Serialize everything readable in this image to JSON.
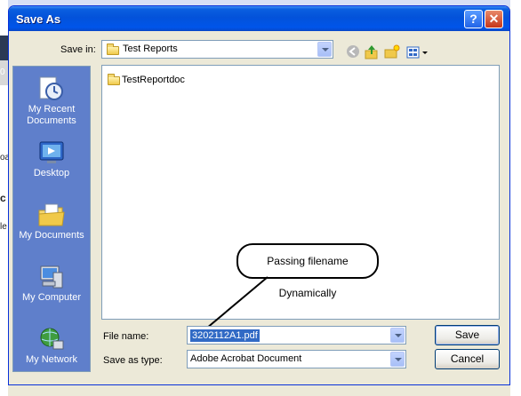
{
  "dialog": {
    "title": "Save As"
  },
  "toolbar": {
    "save_in_label": "Save in:",
    "save_in_value": "Test Reports"
  },
  "places": [
    {
      "label": "My Recent Documents",
      "icon": "recent-documents-icon"
    },
    {
      "label": "Desktop",
      "icon": "desktop-icon"
    },
    {
      "label": "My Documents",
      "icon": "my-documents-icon"
    },
    {
      "label": "My Computer",
      "icon": "my-computer-icon"
    },
    {
      "label": "My Network",
      "icon": "my-network-icon"
    }
  ],
  "files": [
    {
      "name": "TestReportdoc",
      "icon": "folder-icon"
    }
  ],
  "callout": {
    "text": "Passing filename Dynamically"
  },
  "form": {
    "filename_label": "File name:",
    "filename_value": "3202112A1.pdf",
    "savetype_label": "Save as type:",
    "savetype_value": "Adobe Acrobat Document"
  },
  "buttons": {
    "save": "Save",
    "cancel": "Cancel"
  },
  "background": {
    "fragments": [
      "0",
      "oa",
      "c",
      "le"
    ]
  }
}
